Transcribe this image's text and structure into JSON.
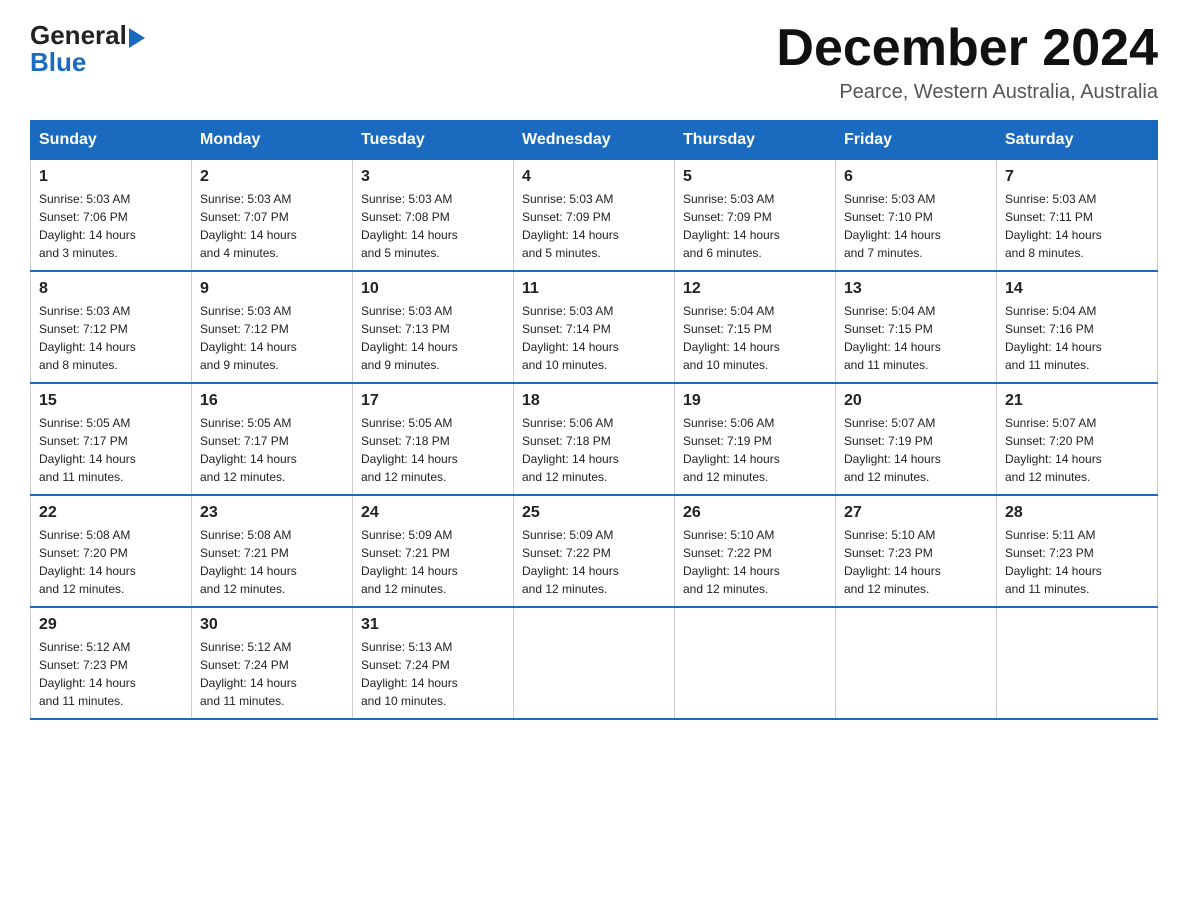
{
  "logo": {
    "general": "General",
    "blue": "Blue"
  },
  "title": "December 2024",
  "location": "Pearce, Western Australia, Australia",
  "days_of_week": [
    "Sunday",
    "Monday",
    "Tuesday",
    "Wednesday",
    "Thursday",
    "Friday",
    "Saturday"
  ],
  "weeks": [
    [
      {
        "day": "1",
        "sunrise": "5:03 AM",
        "sunset": "7:06 PM",
        "daylight": "14 hours and 3 minutes."
      },
      {
        "day": "2",
        "sunrise": "5:03 AM",
        "sunset": "7:07 PM",
        "daylight": "14 hours and 4 minutes."
      },
      {
        "day": "3",
        "sunrise": "5:03 AM",
        "sunset": "7:08 PM",
        "daylight": "14 hours and 5 minutes."
      },
      {
        "day": "4",
        "sunrise": "5:03 AM",
        "sunset": "7:09 PM",
        "daylight": "14 hours and 5 minutes."
      },
      {
        "day": "5",
        "sunrise": "5:03 AM",
        "sunset": "7:09 PM",
        "daylight": "14 hours and 6 minutes."
      },
      {
        "day": "6",
        "sunrise": "5:03 AM",
        "sunset": "7:10 PM",
        "daylight": "14 hours and 7 minutes."
      },
      {
        "day": "7",
        "sunrise": "5:03 AM",
        "sunset": "7:11 PM",
        "daylight": "14 hours and 8 minutes."
      }
    ],
    [
      {
        "day": "8",
        "sunrise": "5:03 AM",
        "sunset": "7:12 PM",
        "daylight": "14 hours and 8 minutes."
      },
      {
        "day": "9",
        "sunrise": "5:03 AM",
        "sunset": "7:12 PM",
        "daylight": "14 hours and 9 minutes."
      },
      {
        "day": "10",
        "sunrise": "5:03 AM",
        "sunset": "7:13 PM",
        "daylight": "14 hours and 9 minutes."
      },
      {
        "day": "11",
        "sunrise": "5:03 AM",
        "sunset": "7:14 PM",
        "daylight": "14 hours and 10 minutes."
      },
      {
        "day": "12",
        "sunrise": "5:04 AM",
        "sunset": "7:15 PM",
        "daylight": "14 hours and 10 minutes."
      },
      {
        "day": "13",
        "sunrise": "5:04 AM",
        "sunset": "7:15 PM",
        "daylight": "14 hours and 11 minutes."
      },
      {
        "day": "14",
        "sunrise": "5:04 AM",
        "sunset": "7:16 PM",
        "daylight": "14 hours and 11 minutes."
      }
    ],
    [
      {
        "day": "15",
        "sunrise": "5:05 AM",
        "sunset": "7:17 PM",
        "daylight": "14 hours and 11 minutes."
      },
      {
        "day": "16",
        "sunrise": "5:05 AM",
        "sunset": "7:17 PM",
        "daylight": "14 hours and 12 minutes."
      },
      {
        "day": "17",
        "sunrise": "5:05 AM",
        "sunset": "7:18 PM",
        "daylight": "14 hours and 12 minutes."
      },
      {
        "day": "18",
        "sunrise": "5:06 AM",
        "sunset": "7:18 PM",
        "daylight": "14 hours and 12 minutes."
      },
      {
        "day": "19",
        "sunrise": "5:06 AM",
        "sunset": "7:19 PM",
        "daylight": "14 hours and 12 minutes."
      },
      {
        "day": "20",
        "sunrise": "5:07 AM",
        "sunset": "7:19 PM",
        "daylight": "14 hours and 12 minutes."
      },
      {
        "day": "21",
        "sunrise": "5:07 AM",
        "sunset": "7:20 PM",
        "daylight": "14 hours and 12 minutes."
      }
    ],
    [
      {
        "day": "22",
        "sunrise": "5:08 AM",
        "sunset": "7:20 PM",
        "daylight": "14 hours and 12 minutes."
      },
      {
        "day": "23",
        "sunrise": "5:08 AM",
        "sunset": "7:21 PM",
        "daylight": "14 hours and 12 minutes."
      },
      {
        "day": "24",
        "sunrise": "5:09 AM",
        "sunset": "7:21 PM",
        "daylight": "14 hours and 12 minutes."
      },
      {
        "day": "25",
        "sunrise": "5:09 AM",
        "sunset": "7:22 PM",
        "daylight": "14 hours and 12 minutes."
      },
      {
        "day": "26",
        "sunrise": "5:10 AM",
        "sunset": "7:22 PM",
        "daylight": "14 hours and 12 minutes."
      },
      {
        "day": "27",
        "sunrise": "5:10 AM",
        "sunset": "7:23 PM",
        "daylight": "14 hours and 12 minutes."
      },
      {
        "day": "28",
        "sunrise": "5:11 AM",
        "sunset": "7:23 PM",
        "daylight": "14 hours and 11 minutes."
      }
    ],
    [
      {
        "day": "29",
        "sunrise": "5:12 AM",
        "sunset": "7:23 PM",
        "daylight": "14 hours and 11 minutes."
      },
      {
        "day": "30",
        "sunrise": "5:12 AM",
        "sunset": "7:24 PM",
        "daylight": "14 hours and 11 minutes."
      },
      {
        "day": "31",
        "sunrise": "5:13 AM",
        "sunset": "7:24 PM",
        "daylight": "14 hours and 10 minutes."
      },
      null,
      null,
      null,
      null
    ]
  ],
  "labels": {
    "sunrise": "Sunrise:",
    "sunset": "Sunset:",
    "daylight": "Daylight:"
  }
}
